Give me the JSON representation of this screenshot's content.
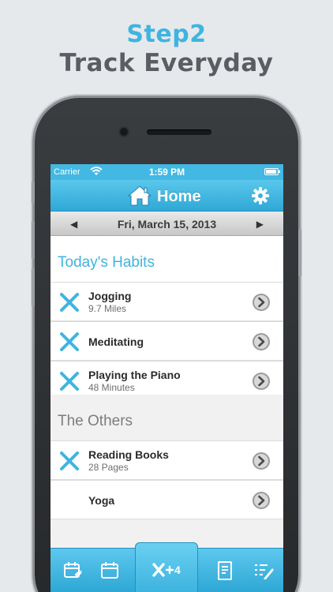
{
  "promo": {
    "step": "Step2",
    "title": "Track Everyday"
  },
  "status_bar": {
    "carrier": "Carrier",
    "time": "1:59 PM"
  },
  "nav": {
    "title": "Home",
    "left_icon": "home-icon",
    "right_icon": "gear-icon"
  },
  "date_bar": {
    "prev": "◀",
    "date": "Fri, March 15, 2013",
    "next": "▶"
  },
  "sections": {
    "habits_title": "Today's Habits",
    "others_title": "The Others"
  },
  "habits": [
    {
      "name": "Jogging",
      "sub": "9.7 Miles",
      "checked": true
    },
    {
      "name": "Meditating",
      "sub": "",
      "checked": true
    },
    {
      "name": "Playing the Piano",
      "sub": "48 Minutes",
      "checked": true
    }
  ],
  "others": [
    {
      "name": "Reading Books",
      "sub": "28 Pages",
      "checked": true
    },
    {
      "name": "Yoga",
      "sub": "",
      "checked": false
    }
  ],
  "tab_bar": {
    "tabs": [
      "calendar-repeat-icon",
      "calendar-icon",
      "check-count-icon",
      "document-icon",
      "list-edit-icon"
    ],
    "active_badge": "4"
  },
  "colors": {
    "accent": "#3fb4e0",
    "nav_blue": "#42b8e2",
    "title_gray": "#5a5e62"
  }
}
